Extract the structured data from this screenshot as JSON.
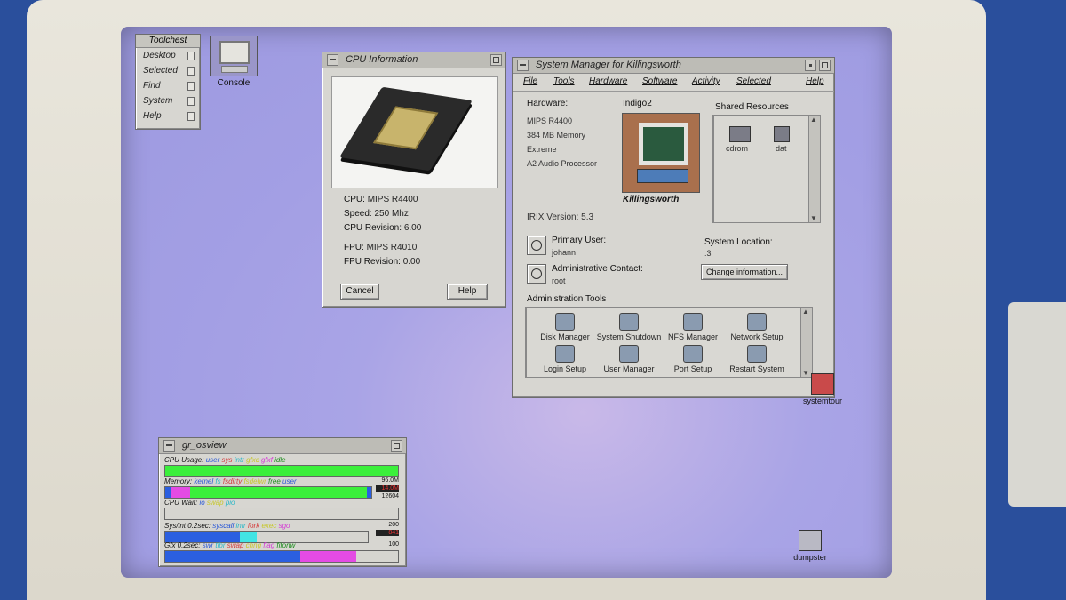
{
  "toolchest": {
    "title": "Toolchest",
    "items": [
      "Desktop",
      "Selected",
      "Find",
      "System",
      "Help"
    ]
  },
  "desktop": {
    "console_label": "Console",
    "icons_right": [
      "systemtour",
      "dumpster"
    ]
  },
  "cpu_window": {
    "title": "CPU Information",
    "rows": [
      {
        "label": "CPU:",
        "value": "MIPS R4400"
      },
      {
        "label": "Speed:",
        "value": "250 Mhz"
      },
      {
        "label": "CPU Revision:",
        "value": "6.00"
      },
      {
        "label": "FPU:",
        "value": "MIPS R4010"
      },
      {
        "label": "FPU Revision:",
        "value": "0.00"
      }
    ],
    "cancel_label": "Cancel",
    "help_label": "Help"
  },
  "sysmgr": {
    "title": "System Manager for Killingsworth",
    "menu": [
      "File",
      "Tools",
      "Hardware",
      "Software",
      "Activity",
      "Selected",
      "Help"
    ],
    "hardware_label": "Hardware:",
    "hardware_items": [
      "MIPS R4400",
      "384 MB Memory",
      "Extreme",
      "A2 Audio Processor"
    ],
    "machine_model": "Indigo2",
    "machine_name": "Killingsworth",
    "shared_label": "Shared Resources",
    "shared_items": [
      "cdrom",
      "dat"
    ],
    "irix_label": "IRIX Version:",
    "irix_value": "5.3",
    "primary_user_label": "Primary User:",
    "primary_user_value": "johann",
    "location_label": "System Location:",
    "location_value": ":3",
    "admin_contact_label": "Administrative Contact:",
    "admin_contact_value": "root",
    "change_info_label": "Change information...",
    "admin_tools_label": "Administration Tools",
    "tools": [
      "Disk Manager",
      "System Shutdown",
      "NFS Manager",
      "Network Setup",
      "Login Setup",
      "User Manager",
      "Port Setup",
      "Restart System"
    ]
  },
  "osview": {
    "title": "gr_osview",
    "cpu_usage": {
      "label": "CPU Usage:",
      "legend": [
        "user",
        "sys",
        "intr",
        "gfxc",
        "gfxf",
        "idle"
      ]
    },
    "memory": {
      "label": "Memory:",
      "legend": [
        "kernel",
        "fs",
        "fsdirty",
        "fsdelwr",
        "free",
        "user"
      ],
      "values": [
        "96.0M",
        "14.0M",
        "12604"
      ]
    },
    "cpu_wait": {
      "label": "CPU Wait:",
      "legend": [
        "io",
        "swap",
        "pio"
      ]
    },
    "syscall": {
      "label": "Sys/int 0.2sec:",
      "legend": [
        "syscall",
        "intr",
        "fork",
        "exec",
        "sgo"
      ],
      "values": [
        "200",
        "841"
      ]
    },
    "gfx": {
      "label": "Gfx 0.2sec:",
      "legend": [
        "swr",
        "tlbr",
        "swap",
        "chng",
        "flag",
        "fifonw"
      ],
      "values": [
        "100"
      ]
    }
  },
  "colors": {
    "screen": "#a39fe4",
    "window": "#d7d6d1",
    "bar_green": "#3bef3b",
    "bar_blue": "#2b5fe0",
    "bar_magenta": "#e44be4",
    "bar_cyan": "#41e4e4"
  }
}
